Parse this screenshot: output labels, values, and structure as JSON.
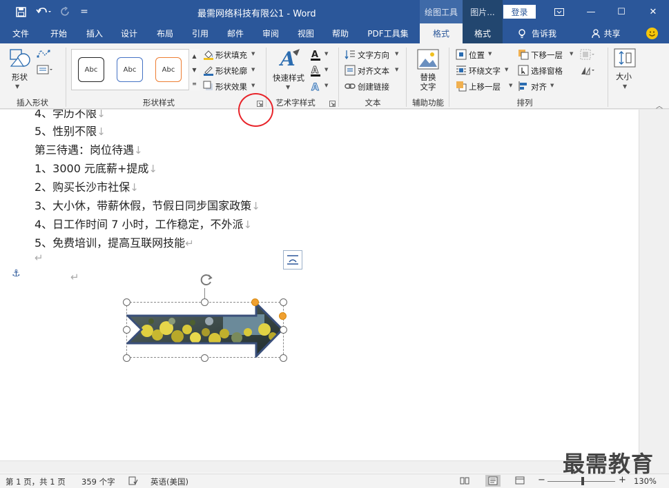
{
  "window": {
    "title": "最需网络科技有限公1 - Word",
    "context_tabs": [
      "绘图工具",
      "图片..."
    ],
    "login_label": "登录",
    "controls": [
      "—",
      "☐",
      "✕"
    ]
  },
  "quick_access": {
    "more": "="
  },
  "tabs": [
    "文件",
    "开始",
    "插入",
    "设计",
    "布局",
    "引用",
    "邮件",
    "审阅",
    "视图",
    "帮助",
    "PDF工具集",
    "格式",
    "格式"
  ],
  "tell_me": "告诉我",
  "share": "共享",
  "ribbon": {
    "insert_shapes": {
      "shapes_label": "形状",
      "group_label": "插入形状"
    },
    "shape_styles": {
      "gallery": [
        "Abc",
        "Abc",
        "Abc"
      ],
      "fill": "形状填充",
      "outline": "形状轮廓",
      "effects": "形状效果",
      "group_label": "形状样式"
    },
    "wordart": {
      "quick_styles": "快速样式",
      "group_label": "艺术字样式"
    },
    "text": {
      "direction": "文字方向",
      "align": "对齐文本",
      "link": "创建链接",
      "group_label": "文本"
    },
    "accessibility": {
      "alt_text": "替换文字",
      "group_label": "辅助功能"
    },
    "arrange": {
      "position": "位置",
      "wrap": "环绕文字",
      "bring_forward": "上移一层",
      "send_backward": "下移一层",
      "selection_pane": "选择窗格",
      "align": "对齐",
      "group_label": "排列"
    },
    "size": {
      "label": "大小"
    }
  },
  "document": {
    "lines": [
      "4、学历不限",
      "5、性别不限",
      "第三待遇：岗位待遇",
      "1、3000 元底薪+提成",
      "2、购买长沙市社保",
      "3、大小休，带薪休假，节假日同步国家政策",
      "4、日工作时间 7 小时，工作稳定，不外派",
      "5、免费培训，提高互联网技能"
    ],
    "line_marks": [
      "↓",
      "↓",
      "↓",
      "↓",
      "↓",
      "↓",
      "↓",
      "↵"
    ],
    "empty_marks": [
      "↵",
      "↵"
    ],
    "anchor": "⚓"
  },
  "status": {
    "page": "第 1 页，共 1 页",
    "words": "359 个字",
    "language": "英语(美国)",
    "zoom": "130%",
    "zoom_minus": "−",
    "zoom_plus": "+"
  },
  "watermark": "最需教育",
  "colors": {
    "title_bar": "#2b579a",
    "ribbon": "#f3f3f3",
    "highlight_circle": "#e8242a",
    "arrow_border": "#3a4f7a"
  }
}
